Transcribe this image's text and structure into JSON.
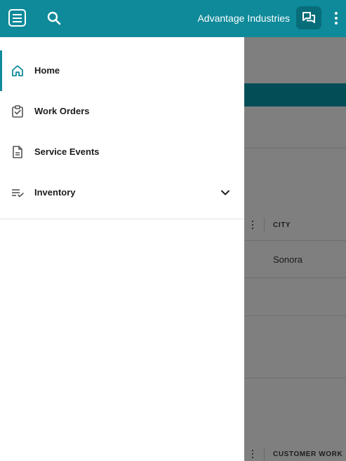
{
  "topbar": {
    "company_name": "Advantage Industries",
    "menu_icon": "hamburger-menu-icon",
    "search_icon": "search-icon",
    "chat_icon": "chat-icon",
    "more_icon": "more-vertical-icon",
    "accent_color": "#0e8a9a"
  },
  "nav": {
    "items": [
      {
        "label": "Home",
        "icon": "home-icon",
        "active": true
      },
      {
        "label": "Work Orders",
        "icon": "clipboard-check-icon",
        "active": false
      },
      {
        "label": "Service Events",
        "icon": "document-icon",
        "active": false
      },
      {
        "label": "Inventory",
        "icon": "list-check-icon",
        "active": false,
        "expandable": true
      }
    ]
  },
  "background": {
    "columns": [
      "CITY",
      "CUSTOMER WORK"
    ],
    "rows": [
      {
        "city": "Sonora"
      }
    ]
  }
}
